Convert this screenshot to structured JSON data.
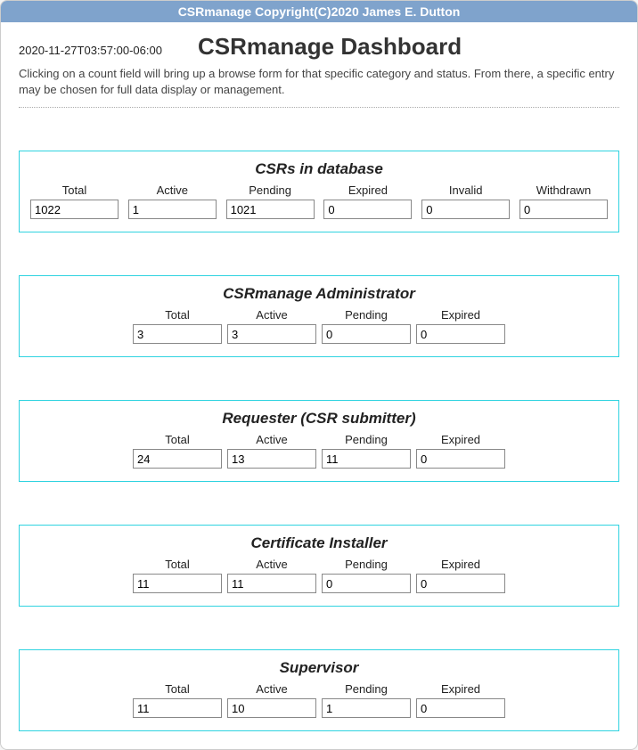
{
  "app": {
    "titlebar": "CSRmanage Copyright(C)2020 James E. Dutton",
    "timestamp": "2020-11-27T03:57:00-06:00",
    "page_title": "CSRmanage Dashboard",
    "description": "Clicking on a count field will bring up a browse form for that specific category and status. From there, a specific entry may be chosen for full data display or management."
  },
  "sections": {
    "csrs": {
      "title": "CSRs in database",
      "labels": {
        "total": "Total",
        "active": "Active",
        "pending": "Pending",
        "expired": "Expired",
        "invalid": "Invalid",
        "withdrawn": "Withdrawn"
      },
      "values": {
        "total": "1022",
        "active": "1",
        "pending": "1021",
        "expired": "0",
        "invalid": "0",
        "withdrawn": "0"
      }
    },
    "admin": {
      "title": "CSRmanage Administrator",
      "labels": {
        "total": "Total",
        "active": "Active",
        "pending": "Pending",
        "expired": "Expired"
      },
      "values": {
        "total": "3",
        "active": "3",
        "pending": "0",
        "expired": "0"
      }
    },
    "requester": {
      "title": "Requester (CSR submitter)",
      "labels": {
        "total": "Total",
        "active": "Active",
        "pending": "Pending",
        "expired": "Expired"
      },
      "values": {
        "total": "24",
        "active": "13",
        "pending": "11",
        "expired": "0"
      }
    },
    "installer": {
      "title": "Certificate Installer",
      "labels": {
        "total": "Total",
        "active": "Active",
        "pending": "Pending",
        "expired": "Expired"
      },
      "values": {
        "total": "11",
        "active": "11",
        "pending": "0",
        "expired": "0"
      }
    },
    "supervisor": {
      "title": "Supervisor",
      "labels": {
        "total": "Total",
        "active": "Active",
        "pending": "Pending",
        "expired": "Expired"
      },
      "values": {
        "total": "11",
        "active": "10",
        "pending": "1",
        "expired": "0"
      }
    }
  }
}
